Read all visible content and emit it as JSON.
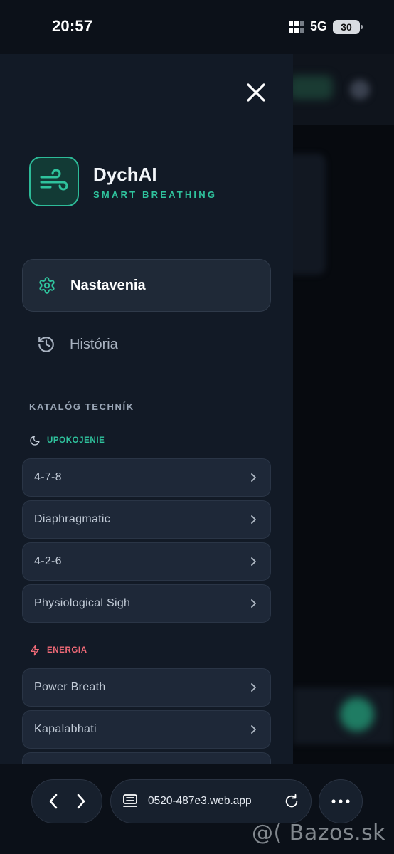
{
  "status_bar": {
    "time": "20:57",
    "network": "5G",
    "battery": "30"
  },
  "drawer": {
    "close_icon": "close-icon",
    "brand": {
      "name": "DychAI",
      "tagline": "SMART BREATHING",
      "logo_icon": "wind-icon",
      "accent_color": "#2fc39d"
    },
    "nav_items": [
      {
        "label": "Nastavenia",
        "icon": "gear-icon",
        "active": true
      },
      {
        "label": "História",
        "icon": "history-icon",
        "active": false
      }
    ],
    "catalog": {
      "heading": "KATALÓG TECHNÍK",
      "categories": [
        {
          "label": "UPOKOJENIE",
          "icon": "moon-icon",
          "color": "#2fc39d",
          "items": [
            "4-7-8",
            "Diaphragmatic",
            "4-2-6",
            "Physiological Sigh"
          ]
        },
        {
          "label": "ENERGIA",
          "icon": "lightning-icon",
          "color": "#ef6a77",
          "items": [
            "Power Breath",
            "Kapalabhati"
          ]
        }
      ]
    }
  },
  "browser": {
    "url": "0520-487e3.web.app",
    "back_icon": "chevron-left-icon",
    "forward_icon": "chevron-right-icon",
    "tabs_icon": "tabs-icon",
    "reload_icon": "reload-icon",
    "more_icon": "more-icon"
  },
  "watermark": "@( Bazos.sk"
}
